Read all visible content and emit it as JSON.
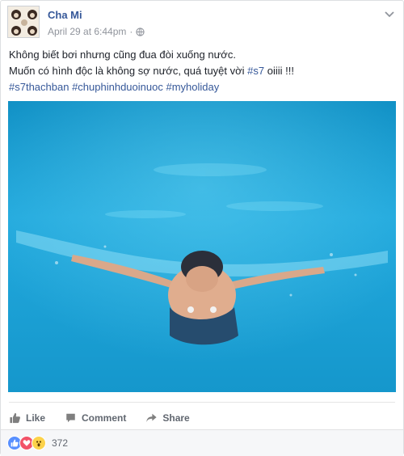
{
  "post": {
    "author": "Cha Mi",
    "timestamp": "April 29 at 6:44pm",
    "separator": "·",
    "lines": {
      "line1": "Không biết bơi nhưng cũng đua đòi xuống nước.",
      "line2_prefix": "Muốn có hình độc là không sợ nước, quá tuyệt vời ",
      "line2_tag": "#s7",
      "line2_suffix": " oiiii !!!",
      "tag1": "#s7thachban",
      "tag2": "#chuphinhduoinuoc",
      "tag3": "#myholiday"
    },
    "photo_icon": "underwater-photo"
  },
  "actions": {
    "like": "Like",
    "comment": "Comment",
    "share": "Share"
  },
  "reactions": {
    "icons": [
      "like-icon",
      "love-icon",
      "wow-icon"
    ],
    "count": "372"
  },
  "colors": {
    "link": "#365899",
    "meta": "#90949c",
    "water": "#1aa3d6"
  }
}
